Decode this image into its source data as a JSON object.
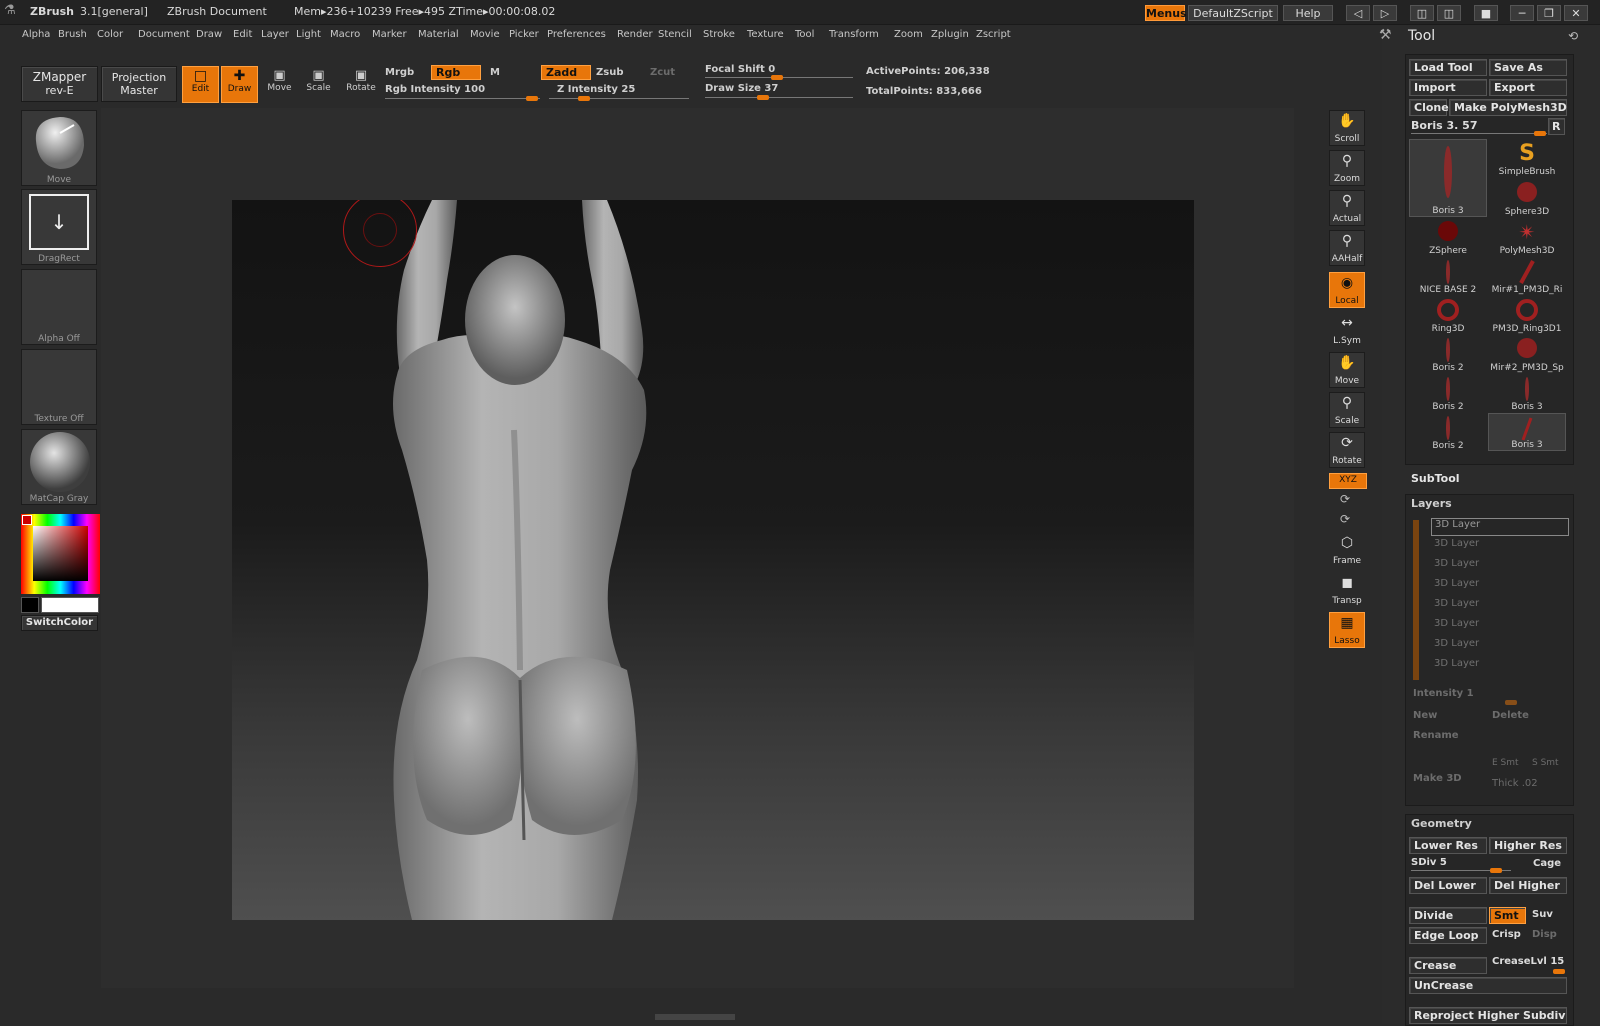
{
  "titlebar": {
    "app": "ZBrush",
    "version": "3.1[general]",
    "document": "ZBrush Document",
    "mem": "Mem▸236+10239  Free▸495  ZTime▸00:00:08.02",
    "menus_btn": "Menus",
    "script_btn": "DefaultZScript",
    "help_btn": "Help"
  },
  "menubar": [
    "Alpha",
    "Brush",
    "Color",
    "Document",
    "Draw",
    "Edit",
    "Layer",
    "Light",
    "Macro",
    "Marker",
    "Material",
    "Movie",
    "Picker",
    "Preferences",
    "Render",
    "Stencil",
    "Stroke",
    "Texture",
    "Tool",
    "Transform",
    "Zoom",
    "Zplugin",
    "Zscript"
  ],
  "shelf": {
    "zmapper": "ZMapper",
    "zmapper_sub": "rev-E",
    "projection": "Projection",
    "projection_sub": "Master",
    "edit": "Edit",
    "draw": "Draw",
    "move": "Move",
    "scale": "Scale",
    "rotate": "Rotate",
    "mrgb": "Mrgb",
    "rgb": "Rgb",
    "m": "M",
    "rgb_intensity": "Rgb  Intensity 100",
    "zadd": "Zadd",
    "zsub": "Zsub",
    "zcut": "Zcut",
    "z_intensity": "Z  Intensity 25",
    "focal_shift": "Focal Shift 0",
    "draw_size": "Draw  Size 37",
    "active_points": "ActivePoints: 206,338",
    "total_points": "TotalPoints: 833,666"
  },
  "left_tray": {
    "brush": "Move",
    "stroke": "DragRect",
    "alpha": "Alpha  Off",
    "texture": "Texture  Off",
    "material": "MatCap  Gray",
    "switch_color": "SwitchColor"
  },
  "right_shelf": [
    "Scroll",
    "Zoom",
    "Actual",
    "AAHalf",
    "Local",
    "L.Sym",
    "Move",
    "Scale",
    "Rotate",
    "XYZ",
    "Frame",
    "Transp",
    "Lasso"
  ],
  "tool_panel": {
    "title": "Tool",
    "load_tool": "Load Tool",
    "save_as": "Save As",
    "import": "Import",
    "export": "Export",
    "clone": "Clone",
    "make_polymesh": "Make PolyMesh3D",
    "current_tool": "Boris 3. 57",
    "r": "R",
    "tools": [
      "Boris 3",
      "SimpleBrush",
      "ZSphere",
      "Sphere3D",
      "NICE BASE 2",
      "PolyMesh3D",
      "Ring3D",
      "Mir#1_PM3D_Ri",
      "Boris 2",
      "PM3D_Ring3D1",
      "Boris 2",
      "Mir#2_PM3D_Sp",
      "Boris 2",
      "Boris 3"
    ],
    "subtool": "SubTool",
    "layers": "Layers",
    "layer_name": "3D Layer",
    "intensity": "Intensity 1",
    "new": "New",
    "delete": "Delete",
    "rename": "Rename",
    "make3d": "Make 3D",
    "e_smt": "E Smt",
    "s_smt": "S Smt",
    "thick": "Thick .02",
    "geometry": "Geometry",
    "lower_res": "Lower Res",
    "higher_res": "Higher Res",
    "sdiv": "SDiv 5",
    "cage": "Cage",
    "del_lower": "Del Lower",
    "del_higher": "Del Higher",
    "divide": "Divide",
    "smt": "Smt",
    "suv": "Suv",
    "edge_loop": "Edge Loop",
    "crisp": "Crisp",
    "disp": "Disp",
    "crease": "Crease",
    "crease_lvl": "CreaseLvl 15",
    "uncrease": "UnCrease",
    "reproject": "Reproject Higher Subdiv"
  },
  "colors": {
    "accent": "#e8760a",
    "panel": "#2b2b2b",
    "button": "#353535"
  }
}
